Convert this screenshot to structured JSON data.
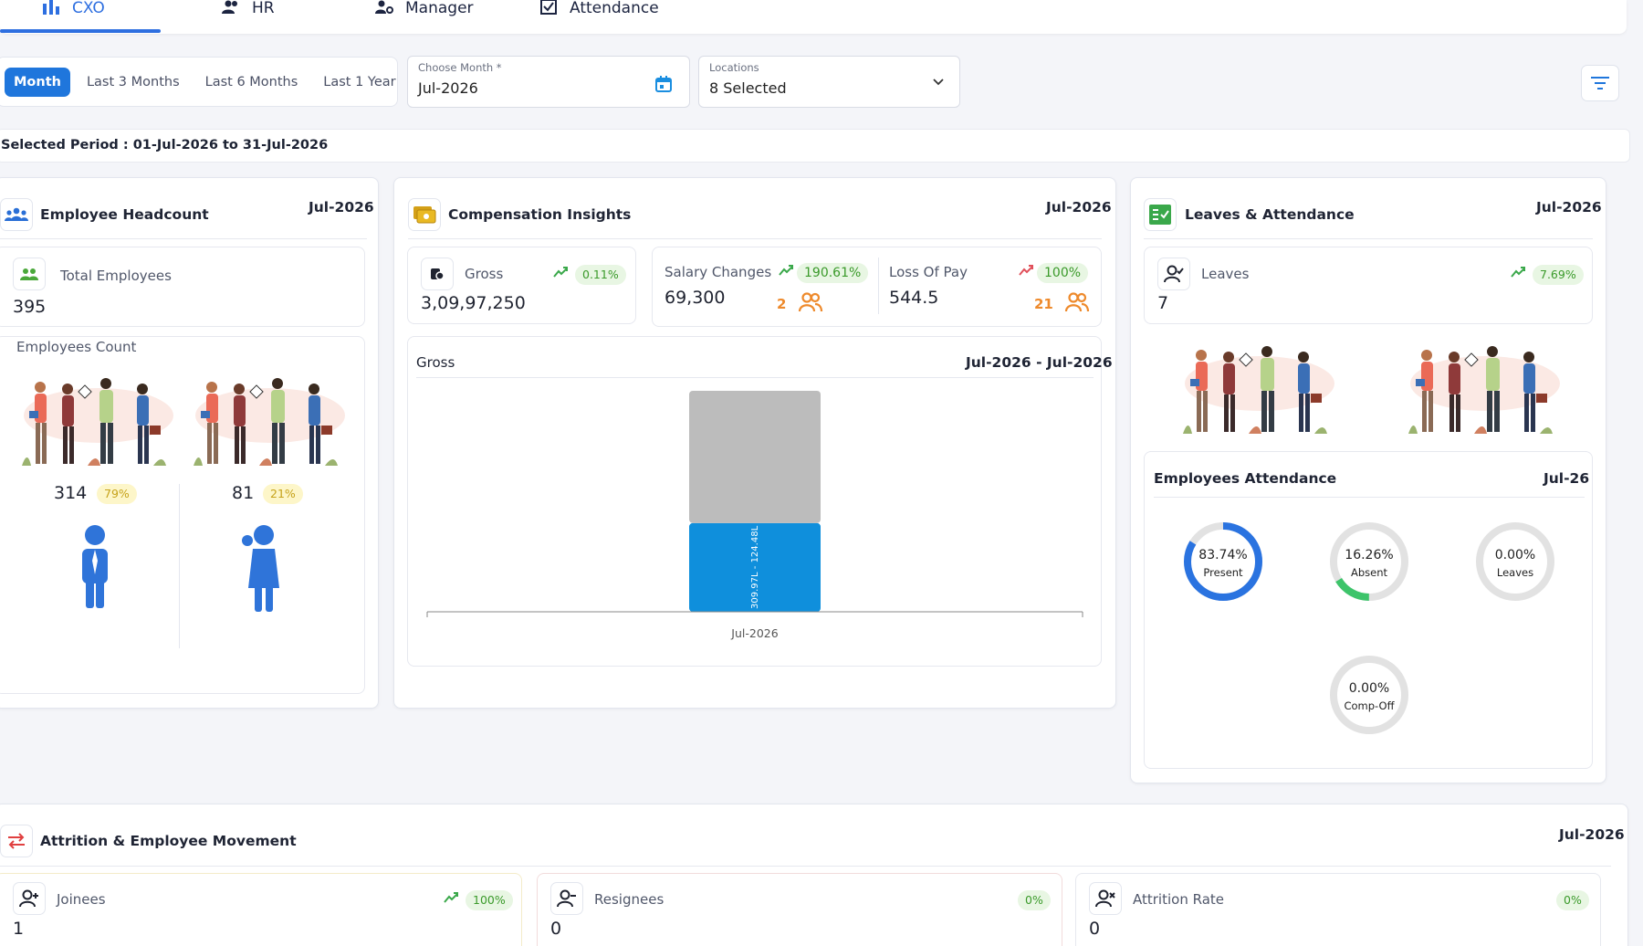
{
  "tabs": [
    {
      "label": "CXO",
      "active": true
    },
    {
      "label": "HR"
    },
    {
      "label": "Manager"
    },
    {
      "label": "Attendance"
    }
  ],
  "period_buttons": [
    "Month",
    "Last 3 Months",
    "Last 6 Months",
    "Last 1 Year"
  ],
  "choose_month": {
    "label": "Choose Month *",
    "value": "Jul-2026"
  },
  "locations": {
    "label": "Locations",
    "value": "8 Selected"
  },
  "selected_period": "Selected Period : 01-Jul-2026 to 31-Jul-2026",
  "headcount": {
    "title": "Employee Headcount",
    "date": "Jul-2026",
    "total_label": "Total Employees",
    "total_value": "395",
    "count_label": "Employees Count",
    "male_count": "314",
    "male_pct": "79%",
    "female_count": "81",
    "female_pct": "21%"
  },
  "compensation": {
    "title": "Compensation Insights",
    "date": "Jul-2026",
    "gross_label": "Gross",
    "gross_pct": "0.11%",
    "gross_value": "3,09,97,250",
    "salary_label": "Salary Changes",
    "salary_pct": "190.61%",
    "salary_value": "69,300",
    "salary_count": "2",
    "lop_label": "Loss Of Pay",
    "lop_pct": "100%",
    "lop_value": "544.5",
    "lop_count": "21"
  },
  "chart_data": {
    "type": "bar",
    "title": "Gross",
    "subtitle": "Jul-2026 - Jul-2026",
    "categories": [
      "Jul-2026"
    ],
    "series": [
      {
        "values": [
          124.48
        ],
        "color": "#0f8fdc"
      },
      {
        "values": [
          185.49
        ],
        "color": "#bcbcbc"
      }
    ],
    "bar_label": "309.97L - 124.48L",
    "stacked": true
  },
  "leaves": {
    "title": "Leaves & Attendance",
    "date": "Jul-2026",
    "leaves_label": "Leaves",
    "leaves_pct": "7.69%",
    "leaves_value": "7"
  },
  "attendance": {
    "title": "Employees Attendance",
    "date": "Jul-26",
    "donuts": [
      {
        "pct": "83.74%",
        "label": "Present",
        "value": 83.74,
        "color": "#2a73e0"
      },
      {
        "pct": "16.26%",
        "label": "Absent",
        "value": 16.26,
        "color": "#3dc46a"
      },
      {
        "pct": "0.00%",
        "label": "Leaves",
        "value": 0,
        "color": "#f2a93b"
      },
      {
        "pct": "0.00%",
        "label": "Comp-Off",
        "value": 0,
        "color": "#a65ee0"
      }
    ]
  },
  "attrition": {
    "title": "Attrition & Employee Movement",
    "date": "Jul-2026",
    "joinees_label": "Joinees",
    "joinees_pct": "100%",
    "joinees_value": "1",
    "resignees_label": "Resignees",
    "resignees_pct": "0%",
    "resignees_value": "0",
    "rate_label": "Attrition Rate",
    "rate_pct": "0%",
    "rate_value": "0"
  },
  "colors": {
    "accent": "#1f76dc",
    "green": "#3a9a2a",
    "orange": "#ee8a2c"
  }
}
